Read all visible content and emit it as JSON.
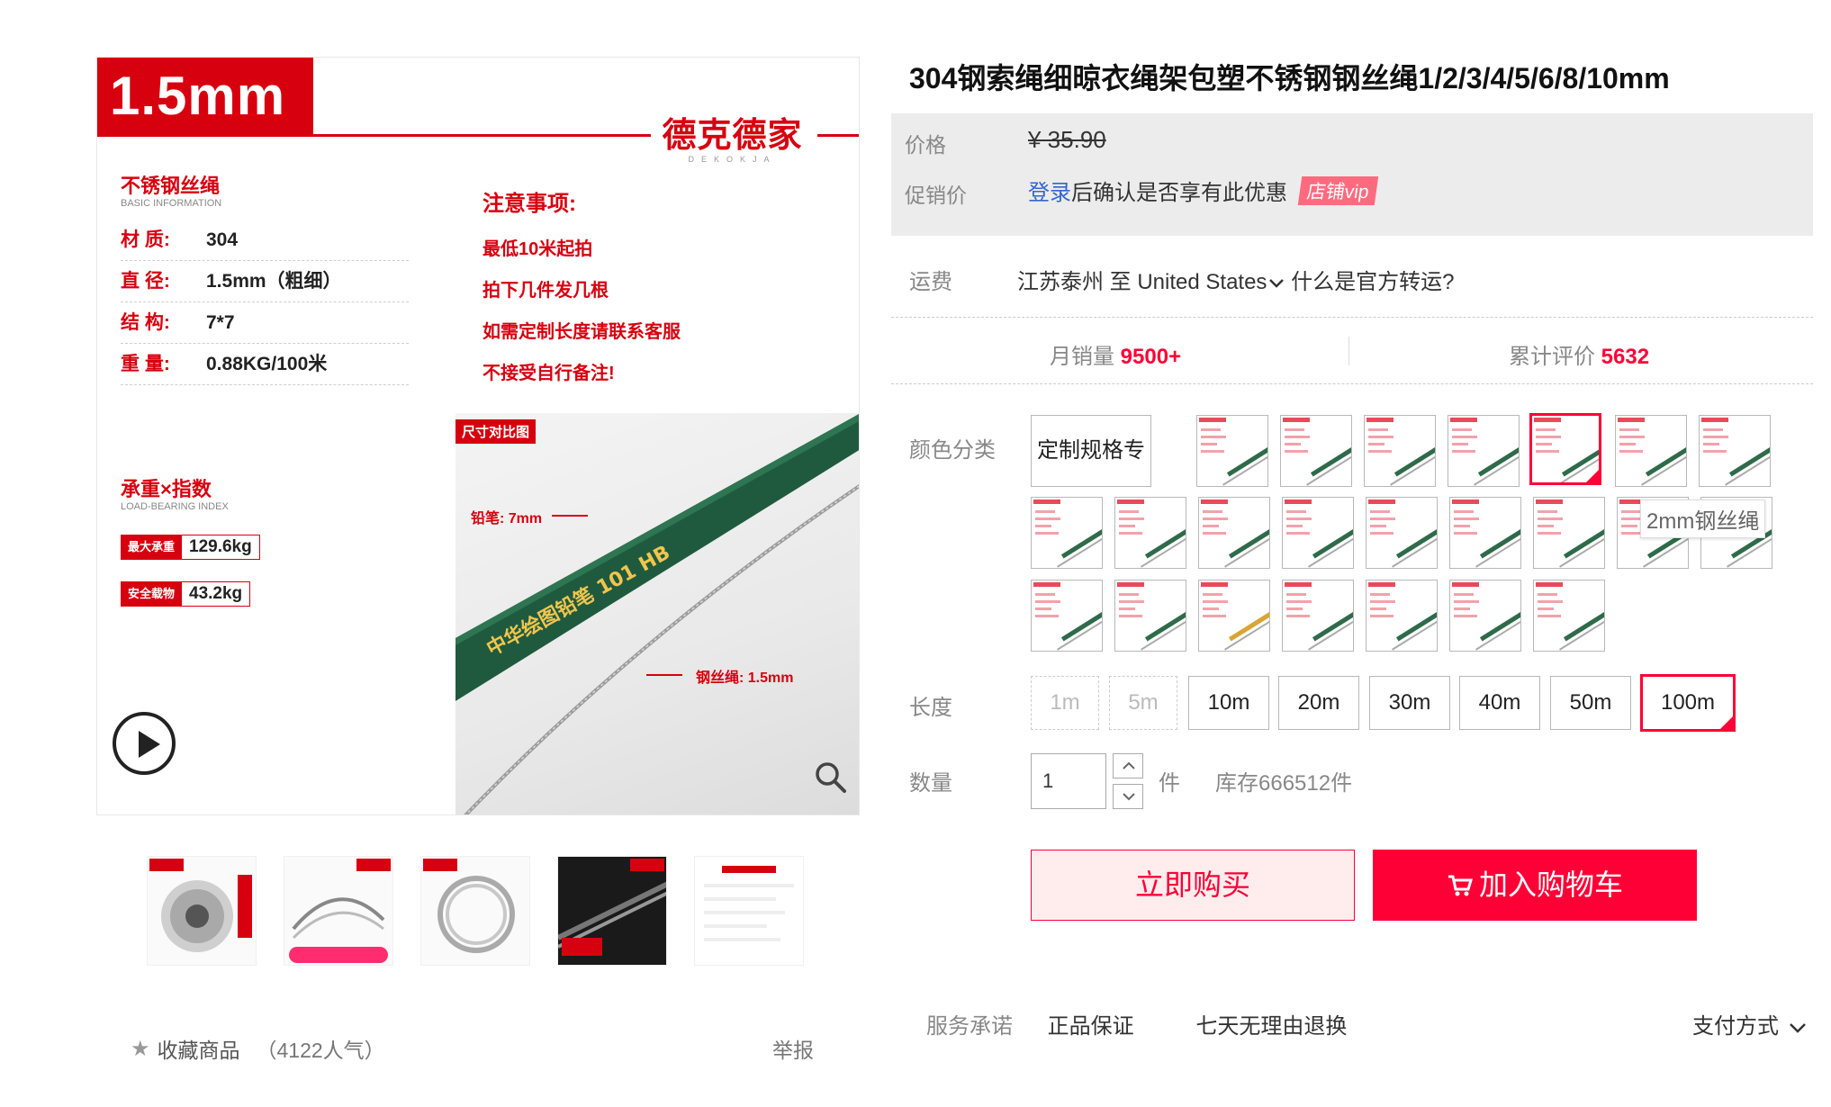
{
  "product": {
    "title": "304钢索绳细晾衣绳架包塑不锈钢钢丝绳1/2/3/4/5/6/8/10mm"
  },
  "main_image": {
    "size_label": "1.5mm",
    "brand": "德克德家",
    "brand_en": "DEKOKJA",
    "basic_title": "不锈钢丝绳",
    "basic_sub": "BASIC INFORMATION",
    "specs": [
      {
        "key": "材  质:",
        "value": "304"
      },
      {
        "key": "直  径:",
        "value": "1.5mm（粗细）"
      },
      {
        "key": "结  构:",
        "value": "7*7"
      },
      {
        "key": "重  量:",
        "value": "0.88KG/100米"
      }
    ],
    "notice_title": "注意事项:",
    "notices": [
      "最低10米起拍",
      "拍下几件发几根",
      "如需定制长度请联系客服",
      "不接受自行备注!"
    ],
    "load_title": "承重×指数",
    "load_sub": "LOAD-BEARING INDEX",
    "loads": [
      {
        "label": "最大承重",
        "value": "129.6kg"
      },
      {
        "label": "安全载物",
        "value": "43.2kg"
      }
    ],
    "compare_tag": "尺寸对比图",
    "pencil_label": "铅笔: 7mm",
    "wire_label": "钢丝绳: 1.5mm",
    "pencil_print": "中华绘图铅笔 101 HB"
  },
  "favorite": {
    "label": "收藏商品",
    "count": "（4122人气）"
  },
  "report_label": "举报",
  "price": {
    "label": "价格",
    "original": "¥ 35.90",
    "promo_label": "促销价",
    "login_link": "登录",
    "promo_text": "后确认是否享有此优惠",
    "vip_badge": "店铺vip"
  },
  "shipping": {
    "label": "运费",
    "origin": "江苏泰州",
    "to": "至",
    "country": "United States",
    "transfer_link": "什么是官方转运?"
  },
  "stats": {
    "monthly_sales_label": "月销量",
    "monthly_sales_value": "9500+",
    "reviews_label": "累计评价",
    "reviews_value": "5632"
  },
  "color": {
    "label": "颜色分类",
    "custom_option": "定制规格专拍",
    "selected_index": 5,
    "tooltip": "2mm钢丝绳"
  },
  "length": {
    "label": "长度",
    "options": [
      "1m",
      "5m",
      "10m",
      "20m",
      "30m",
      "40m",
      "50m",
      "100m"
    ],
    "disabled": [
      "1m",
      "5m"
    ],
    "selected": "100m"
  },
  "quantity": {
    "label": "数量",
    "value": "1",
    "unit": "件",
    "stock": "库存666512件"
  },
  "actions": {
    "buy_now": "立即购买",
    "add_cart": "加入购物车"
  },
  "service": {
    "label": "服务承诺",
    "items": [
      "正品保证",
      "七天无理由退换"
    ],
    "payment": "支付方式"
  },
  "colors": {
    "accent": "#ff0036",
    "brand_red": "#d7000f",
    "link": "#3366cc",
    "price_box_bg": "#ececec"
  },
  "icons": [
    "play-icon",
    "zoom-icon",
    "star-icon",
    "cart-icon",
    "chevron-down-icon",
    "chevron-up-icon"
  ]
}
